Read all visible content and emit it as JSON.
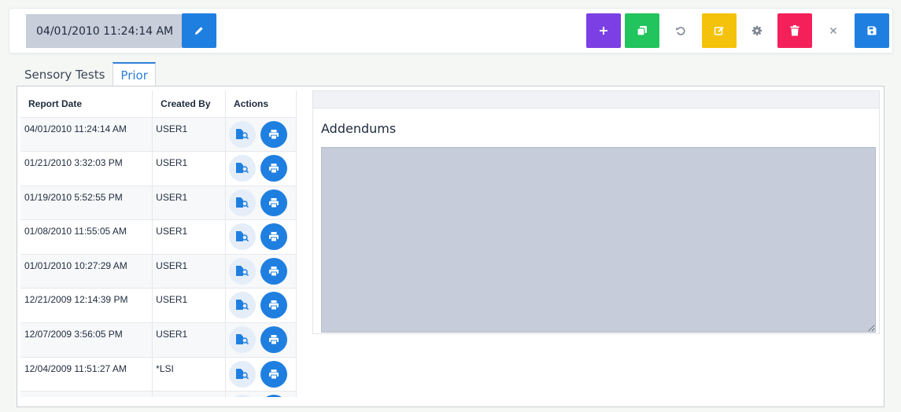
{
  "toolbar": {
    "date_value": "04/01/2010 11:24:14 AM",
    "buttons": {
      "edit_date": {
        "icon": "pencil-icon",
        "color": "#1f7fe0"
      },
      "add": {
        "icon": "plus-icon",
        "color": "#7b3fe4"
      },
      "copy": {
        "icon": "copy-icon",
        "color": "#21c45d"
      },
      "undo": {
        "icon": "undo-icon",
        "color": "transparent"
      },
      "edit": {
        "icon": "edit-icon",
        "color": "#f5c20b"
      },
      "settings": {
        "icon": "gear-icon",
        "color": "transparent"
      },
      "delete": {
        "icon": "trash-icon",
        "color": "#f4205a"
      },
      "close": {
        "icon": "close-icon",
        "color": "transparent"
      },
      "save": {
        "icon": "save-icon",
        "color": "#1f7fe0"
      }
    }
  },
  "tabs": [
    {
      "label": "Sensory Tests",
      "active": false
    },
    {
      "label": "Prior",
      "active": true
    }
  ],
  "reports": {
    "columns": [
      "Report Date",
      "Created By",
      "Actions"
    ],
    "rows": [
      {
        "date": "04/01/2010 11:24:14 AM",
        "created_by": "USER1"
      },
      {
        "date": "01/21/2010 3:32:03 PM",
        "created_by": "USER1"
      },
      {
        "date": "01/19/2010 5:52:55 PM",
        "created_by": "USER1"
      },
      {
        "date": "01/08/2010 11:55:05 AM",
        "created_by": "USER1"
      },
      {
        "date": "01/01/2010 10:27:29 AM",
        "created_by": "USER1"
      },
      {
        "date": "12/21/2009 12:14:39 PM",
        "created_by": "USER1"
      },
      {
        "date": "12/07/2009 3:56:05 PM",
        "created_by": "USER1"
      },
      {
        "date": "12/04/2009 11:51:27 AM",
        "created_by": "*LSI"
      },
      {
        "date": "",
        "created_by": ""
      }
    ],
    "action_icons": [
      "view-report-icon",
      "print-icon"
    ]
  },
  "addendum": {
    "title": "Addendums",
    "value": ""
  }
}
